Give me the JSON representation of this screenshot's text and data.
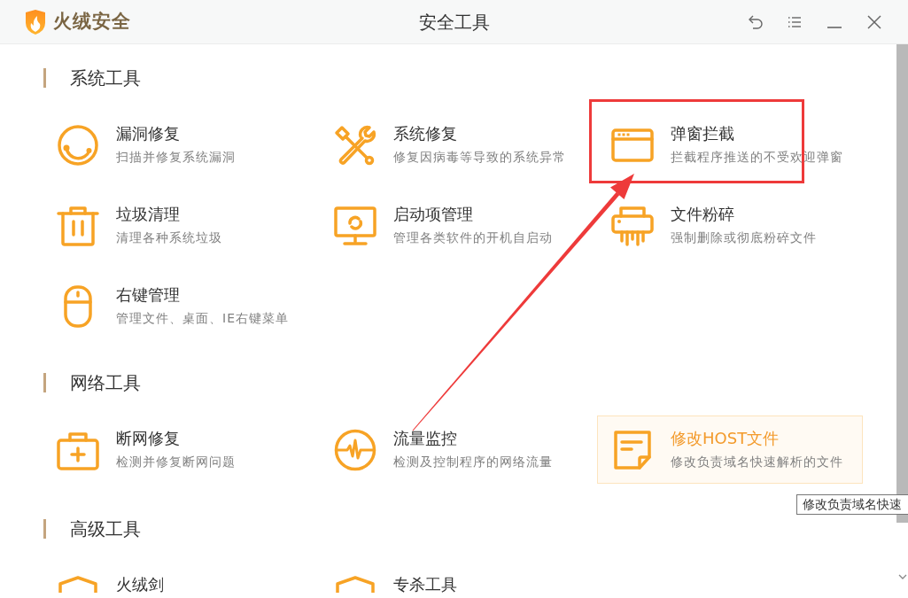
{
  "window": {
    "app_name": "火绒安全",
    "title": "安全工具"
  },
  "sections": [
    {
      "title": "系统工具",
      "items": [
        {
          "title": "漏洞修复",
          "description": "扫描并修复系统漏洞",
          "hovered": false,
          "annotated": false
        },
        {
          "title": "系统修复",
          "description": "修复因病毒等导致的系统异常",
          "hovered": false,
          "annotated": false
        },
        {
          "title": "弹窗拦截",
          "description": "拦截程序推送的不受欢迎弹窗",
          "hovered": false,
          "annotated": true
        },
        {
          "title": "垃圾清理",
          "description": "清理各种系统垃圾",
          "hovered": false,
          "annotated": false
        },
        {
          "title": "启动项管理",
          "description": "管理各类软件的开机自启动",
          "hovered": false,
          "annotated": false
        },
        {
          "title": "文件粉碎",
          "description": "强制删除或彻底粉碎文件",
          "hovered": false,
          "annotated": false
        },
        {
          "title": "右键管理",
          "description": "管理文件、桌面、IE右键菜单",
          "hovered": false,
          "annotated": false
        }
      ]
    },
    {
      "title": "网络工具",
      "items": [
        {
          "title": "断网修复",
          "description": "检测并修复断网问题",
          "hovered": false,
          "annotated": false
        },
        {
          "title": "流量监控",
          "description": "检测及控制程序的网络流量",
          "hovered": false,
          "annotated": false
        },
        {
          "title": "修改HOST文件",
          "description": "修改负责域名快速解析的文件",
          "hovered": true,
          "annotated": false
        }
      ]
    },
    {
      "title": "高级工具",
      "items": [
        {
          "title": "火绒剑",
          "hovered": false,
          "annotated": false
        },
        {
          "title": "专杀工具",
          "hovered": false,
          "annotated": false
        }
      ]
    }
  ],
  "tooltip": {
    "text": "修改负责域名快速"
  }
}
